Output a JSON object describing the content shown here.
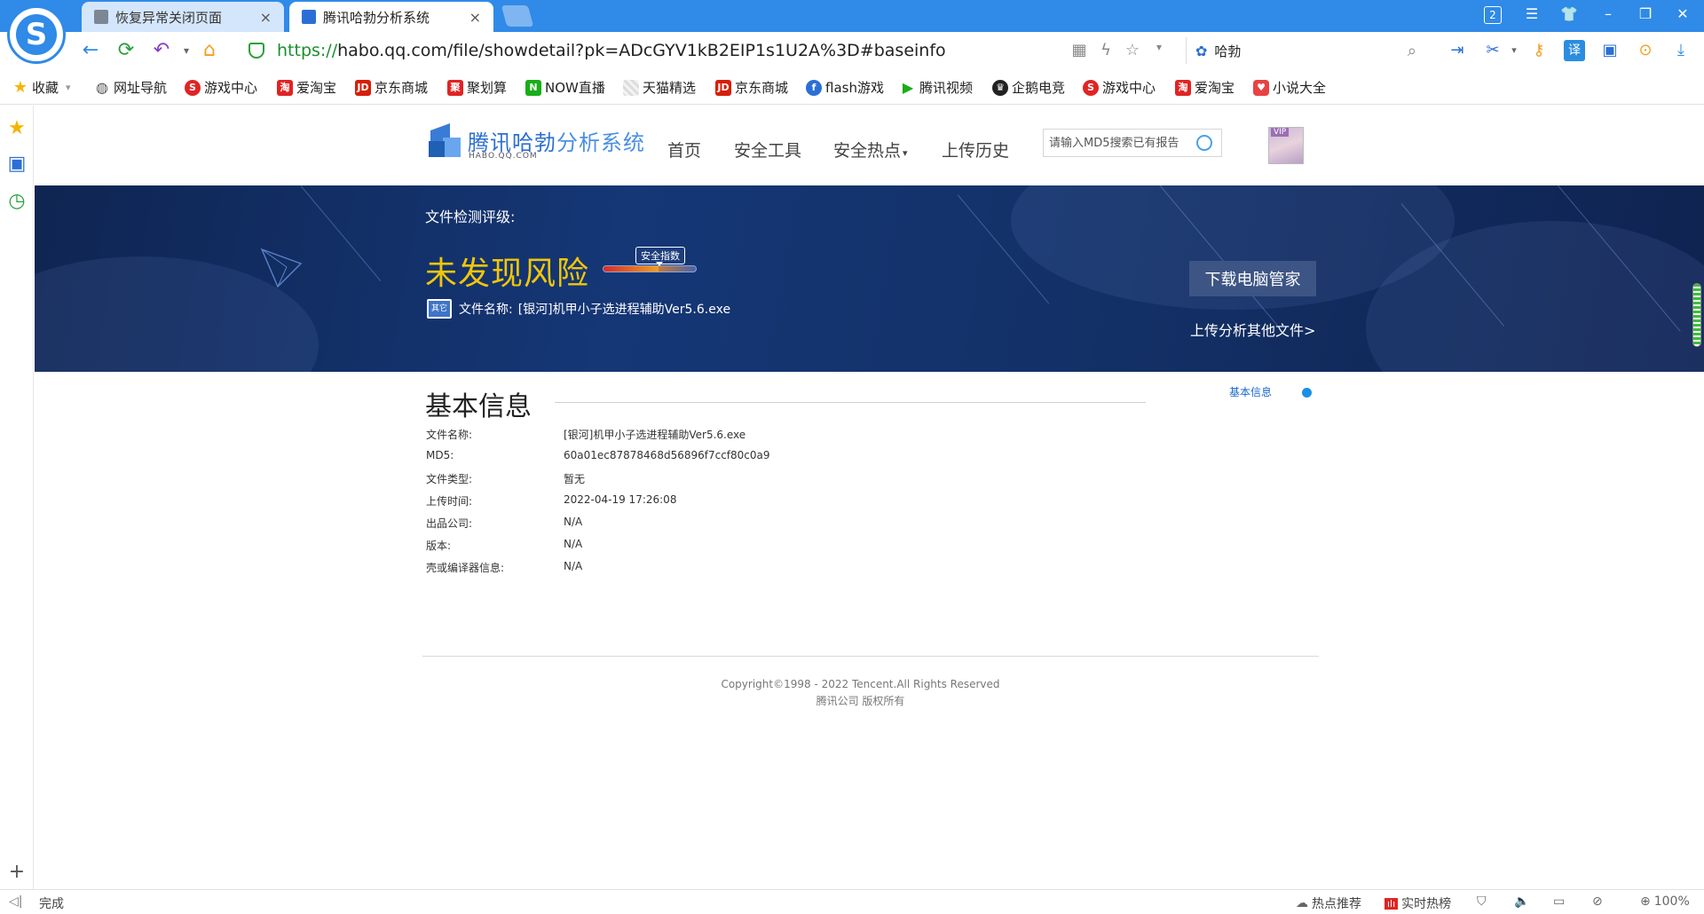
{
  "browser": {
    "tabs": [
      {
        "label": "恢复异常关闭页面",
        "close": "×"
      },
      {
        "label": "腾讯哈勃分析系统",
        "close": "×"
      }
    ],
    "tab_count": "2",
    "address": {
      "protocol": "https://",
      "rest": "habo.qq.com/file/showdetail?pk=ADcGYV1kB2EIP1s1U2A%3D#baseinfo"
    },
    "search": {
      "query": "哈勃"
    },
    "bookmarks": [
      {
        "label": "收藏",
        "icon": "star-icon",
        "color": "#f5b400"
      },
      {
        "label": "网址导航",
        "icon": "globe-icon",
        "color": "#555555"
      },
      {
        "label": "游戏中心",
        "icon": "game-icon",
        "color": "#e02424"
      },
      {
        "label": "爱淘宝",
        "icon": "taobao-icon",
        "color": "#e02424"
      },
      {
        "label": "京东商城",
        "icon": "jd-icon",
        "color": "#d81e06"
      },
      {
        "label": "聚划算",
        "icon": "juhuasuan-icon",
        "color": "#e02424"
      },
      {
        "label": "NOW直播",
        "icon": "now-icon",
        "color": "#1aad19"
      },
      {
        "label": "天猫精选",
        "icon": "tmall-icon",
        "color": "#d0d0d0"
      },
      {
        "label": "京东商城",
        "icon": "jd-icon",
        "color": "#d81e06"
      },
      {
        "label": "flash游戏",
        "icon": "flash-icon",
        "color": "#2b6fd6"
      },
      {
        "label": "腾讯视频",
        "icon": "video-icon",
        "color": "#1aad19"
      },
      {
        "label": "企鹅电竞",
        "icon": "penguin-icon",
        "color": "#222222"
      },
      {
        "label": "游戏中心",
        "icon": "game-icon",
        "color": "#e02424"
      },
      {
        "label": "爱淘宝",
        "icon": "taobao-icon",
        "color": "#e02424"
      },
      {
        "label": "小说大全",
        "icon": "novel-icon",
        "color": "#e84343"
      }
    ],
    "status": {
      "left": "完成",
      "hot": "热点推荐",
      "realtime": "实时热榜",
      "zoom": "100%"
    }
  },
  "site": {
    "brand": {
      "name_main": "腾讯哈勃",
      "name_sub": "分析系统",
      "domain": "HABO.QQ.COM"
    },
    "nav": [
      "首页",
      "安全工具",
      "安全热点",
      "上传历史"
    ],
    "nav_caret": "▾",
    "search_placeholder": "请输入MD5搜索已有报告",
    "avatar_badge": "VIP"
  },
  "banner": {
    "rating_label": "文件检测评级:",
    "result": "未发现风险",
    "safety_tag": "安全指数",
    "safety_level": 0.6,
    "file_icon_text": "其它",
    "file_label": "文件名称:",
    "file_name": "[银河]机甲小子选进程辅助Ver5.6.exe",
    "download_button": "下载电脑管家",
    "upload_link": "上传分析其他文件>"
  },
  "info": {
    "title": "基本信息",
    "anchor": "基本信息",
    "rows": [
      {
        "key": "文件名称:",
        "value": "[银河]机甲小子选进程辅助Ver5.6.exe"
      },
      {
        "key": "MD5:",
        "value": "60a01ec87878468d56896f7ccf80c0a9"
      },
      {
        "key": "文件类型:",
        "value": "暂无"
      },
      {
        "key": "上传时间:",
        "value": "2022-04-19 17:26:08"
      },
      {
        "key": "出品公司:",
        "value": "N/A"
      },
      {
        "key": "版本:",
        "value": "N/A"
      },
      {
        "key": "壳或编译器信息:",
        "value": "N/A"
      }
    ]
  },
  "footer": {
    "copyright": "Copyright©1998 - 2022 Tencent.All Rights Reserved",
    "rights": "腾讯公司 版权所有"
  }
}
